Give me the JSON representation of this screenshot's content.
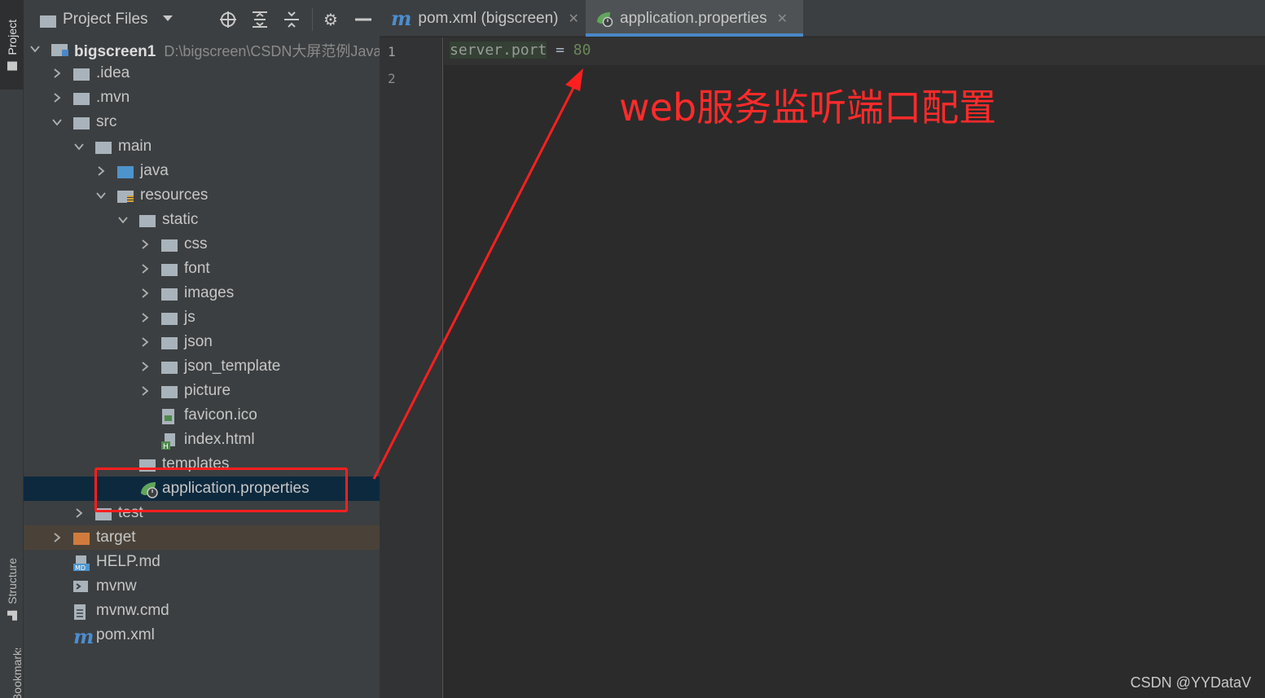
{
  "side_strip": {
    "project_tab": "Project",
    "structure_tab": "Structure",
    "bookmarks_tab": "Bookmarks"
  },
  "panel": {
    "title": "Project Files",
    "toolbar": [
      "locate-icon",
      "expand-all-icon",
      "collapse-all-icon",
      "gear-icon",
      "minimize-icon"
    ]
  },
  "tree": {
    "root": {
      "label": "bigscreen1",
      "path": "D:\\bigscreen\\CSDN大屏范例Java"
    },
    "items": [
      {
        "label": ".idea",
        "depth": 1,
        "expanded": false,
        "kind": "folder"
      },
      {
        "label": ".mvn",
        "depth": 1,
        "expanded": false,
        "kind": "folder"
      },
      {
        "label": "src",
        "depth": 1,
        "expanded": true,
        "kind": "folder"
      },
      {
        "label": "main",
        "depth": 2,
        "expanded": true,
        "kind": "folder"
      },
      {
        "label": "java",
        "depth": 3,
        "expanded": false,
        "kind": "source-folder"
      },
      {
        "label": "resources",
        "depth": 3,
        "expanded": true,
        "kind": "resources-folder"
      },
      {
        "label": "static",
        "depth": 4,
        "expanded": true,
        "kind": "folder"
      },
      {
        "label": "css",
        "depth": 5,
        "expanded": false,
        "kind": "folder"
      },
      {
        "label": "font",
        "depth": 5,
        "expanded": false,
        "kind": "folder"
      },
      {
        "label": "images",
        "depth": 5,
        "expanded": false,
        "kind": "folder"
      },
      {
        "label": "js",
        "depth": 5,
        "expanded": false,
        "kind": "folder"
      },
      {
        "label": "json",
        "depth": 5,
        "expanded": false,
        "kind": "folder"
      },
      {
        "label": "json_template",
        "depth": 5,
        "expanded": false,
        "kind": "folder"
      },
      {
        "label": "picture",
        "depth": 5,
        "expanded": false,
        "kind": "folder"
      },
      {
        "label": "favicon.ico",
        "depth": 5,
        "kind": "image-file"
      },
      {
        "label": "index.html",
        "depth": 5,
        "kind": "html-file"
      },
      {
        "label": "templates",
        "depth": 4,
        "kind": "folder"
      },
      {
        "label": "application.properties",
        "depth": 4,
        "kind": "spring-file",
        "selected": true
      },
      {
        "label": "test",
        "depth": 2,
        "expanded": false,
        "kind": "folder"
      },
      {
        "label": "target",
        "depth": 1,
        "expanded": false,
        "kind": "excluded-folder"
      },
      {
        "label": "HELP.md",
        "depth": 1,
        "kind": "md-file"
      },
      {
        "label": "mvnw",
        "depth": 1,
        "kind": "shell-file"
      },
      {
        "label": "mvnw.cmd",
        "depth": 1,
        "kind": "text-file"
      },
      {
        "label": "pom.xml",
        "depth": 1,
        "kind": "maven-file"
      }
    ]
  },
  "tabs": [
    {
      "label": "pom.xml (bigscreen)",
      "icon": "maven-icon",
      "active": false
    },
    {
      "label": "application.properties",
      "icon": "spring-icon",
      "active": true
    }
  ],
  "editor": {
    "line_numbers": [
      "1",
      "2"
    ],
    "code": {
      "key": "server.port",
      "eq": "=",
      "value": "80"
    }
  },
  "annotation": {
    "text": "web服务监听端口配置",
    "color": "#ff2a2a"
  },
  "watermark": "CSDN @YYDataV",
  "colors": {
    "panel_bg": "#3c3f41",
    "editor_bg": "#2b2b2b",
    "selection": "#0d293e",
    "excluded": "#4a4238",
    "accent": "#4a88c7"
  }
}
